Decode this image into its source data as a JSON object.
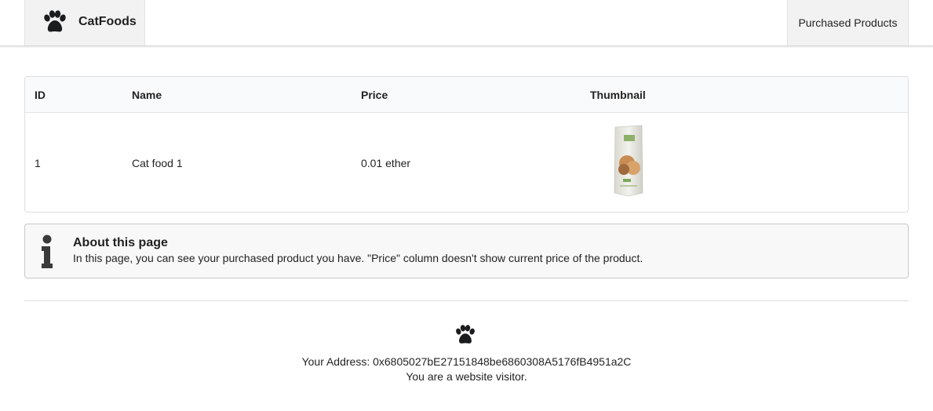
{
  "header": {
    "brand": "CatFoods",
    "brand_icon": "paw-icon",
    "nav_item": "Purchased Products"
  },
  "table": {
    "columns": [
      "ID",
      "Name",
      "Price",
      "Thumbnail"
    ],
    "rows": [
      {
        "id": "1",
        "name": "Cat food 1",
        "price": "0.01 ether",
        "thumbnail": "cat-food-bag-image"
      }
    ]
  },
  "message": {
    "icon": "info-icon",
    "header": "About this page",
    "body": "In this page, you can see your purchased product you have. \"Price\" column doesn't show current price of the product."
  },
  "footer": {
    "icon": "paw-icon",
    "address_line": "Your Address: 0x6805027bE27151848be6860308A5176fB4951a2C",
    "role_line": "You are a website visitor."
  }
}
